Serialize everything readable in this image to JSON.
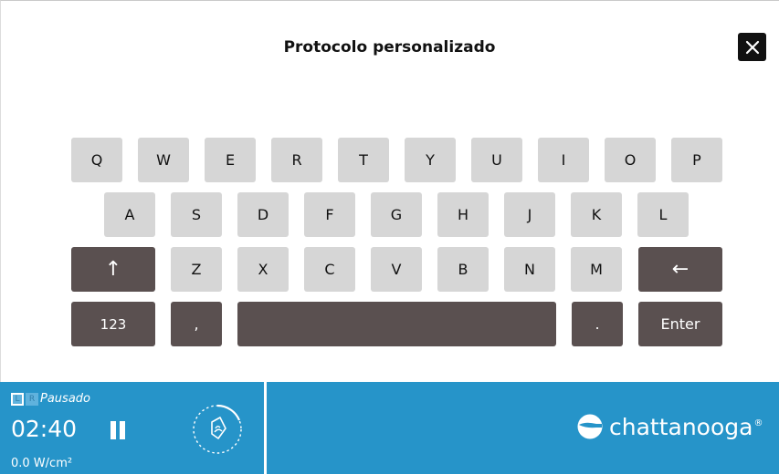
{
  "header": {
    "title": "Protocolo personalizado",
    "close_icon": "close-icon"
  },
  "keyboard": {
    "row1": [
      "Q",
      "W",
      "E",
      "R",
      "T",
      "Y",
      "U",
      "I",
      "O",
      "P"
    ],
    "row2": [
      "A",
      "S",
      "D",
      "F",
      "G",
      "H",
      "J",
      "K",
      "L"
    ],
    "row3": {
      "shift_icon": "shift-up-arrow-icon",
      "shift_glyph": "↑",
      "letters": [
        "Z",
        "X",
        "C",
        "V",
        "B",
        "N",
        "M"
      ],
      "backspace_icon": "backspace-arrow-icon",
      "backspace_glyph": "←"
    },
    "row4": {
      "numbers": "123",
      "comma": ",",
      "space": "",
      "period": ".",
      "enter": "Enter"
    }
  },
  "footer": {
    "channel_left": "L",
    "channel_right": "R",
    "status": "Pausado",
    "timer": "02:40",
    "power": "0.0 W/cm²",
    "brand": "chattanooga",
    "brand_mark": "®",
    "colors": {
      "bar": "#2694c9",
      "dark_key": "#5a5050",
      "light_key": "#d6d6d6"
    }
  }
}
